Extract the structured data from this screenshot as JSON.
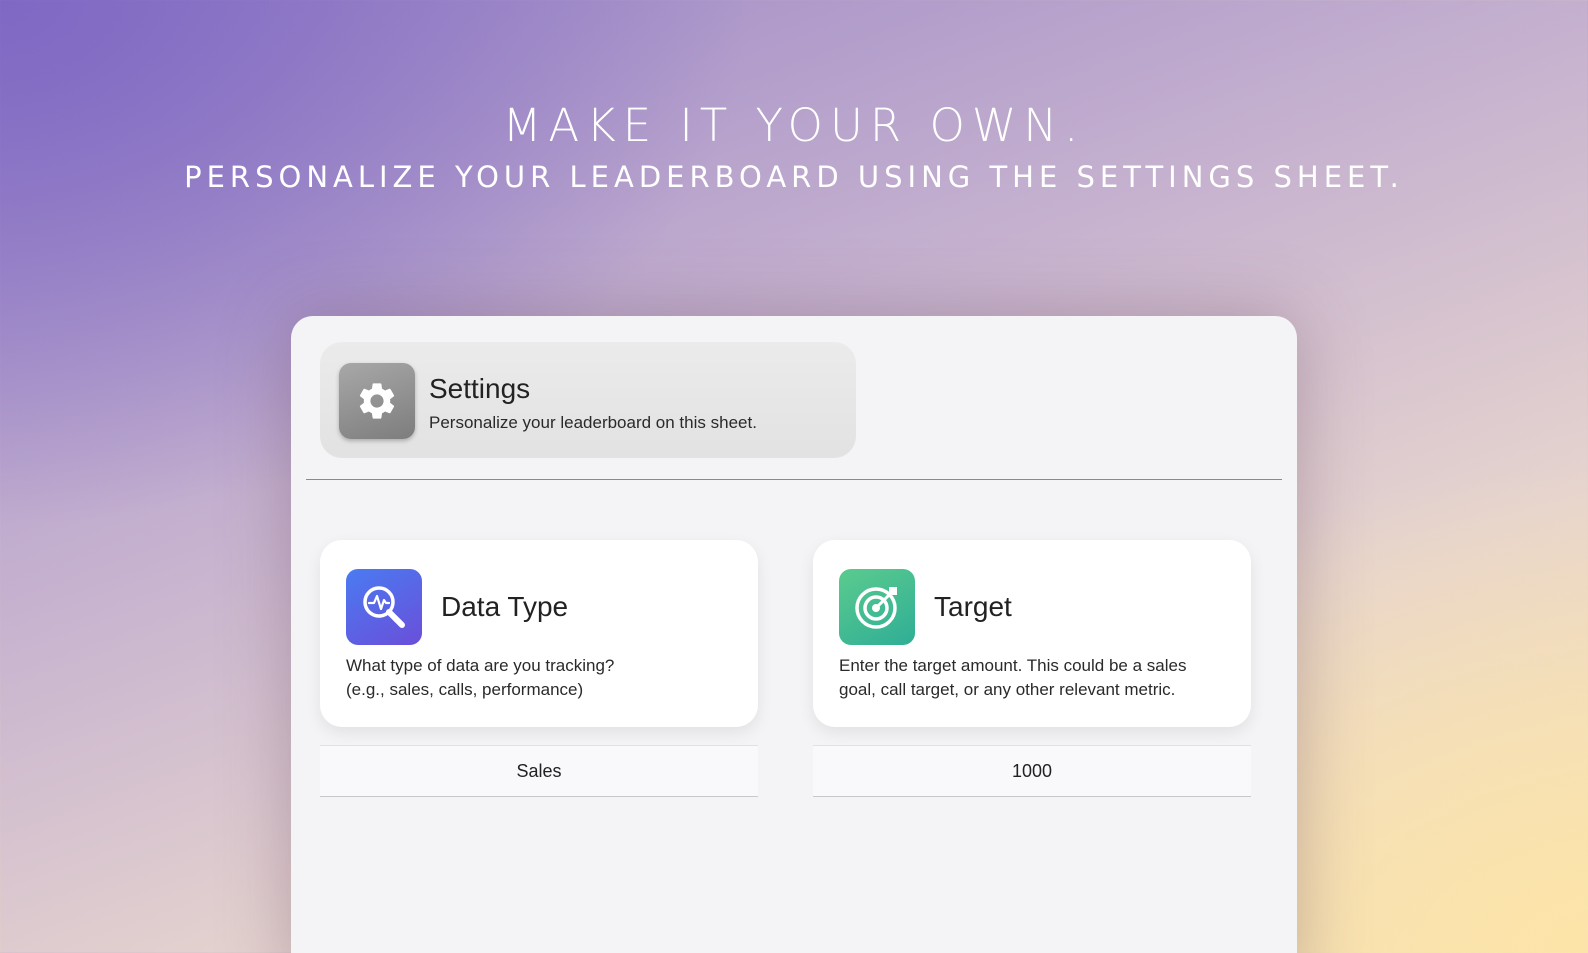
{
  "hero": {
    "title": "MAKE IT YOUR OWN.",
    "subtitle": "PERSONALIZE YOUR LEADERBOARD USING THE SETTINGS SHEET."
  },
  "settings": {
    "icon": "gear-icon",
    "title": "Settings",
    "description": "Personalize your leaderboard on this sheet."
  },
  "cards": [
    {
      "icon": "analytics-search-icon",
      "title": "Data Type",
      "description": "What type of data are you tracking?\n(e.g., sales, calls, performance)",
      "value": "Sales",
      "accent": "#5a66e6"
    },
    {
      "icon": "target-icon",
      "title": "Target",
      "description": "Enter the target amount. This could be a sales\ngoal, call target, or any other relevant metric.",
      "value": "1000",
      "accent": "#3dbb90"
    }
  ],
  "colors": {
    "gradient_top_left": "#7e68c4",
    "gradient_bottom_right": "#fce4a8",
    "sheet_background": "#f4f4f6"
  }
}
